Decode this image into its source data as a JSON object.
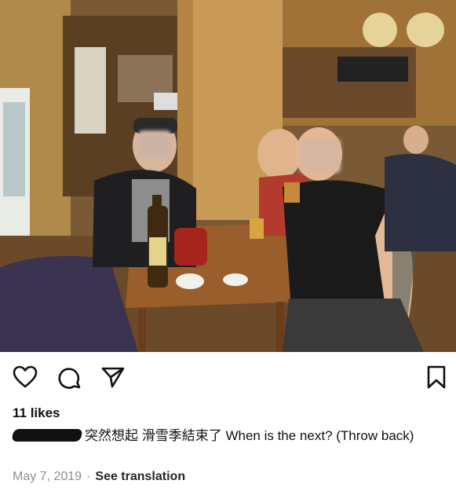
{
  "post": {
    "photo_alt": "",
    "likes": "11 likes",
    "caption": {
      "text": "突然想起 滑雪季結束了 When is the next? (Throw back)"
    },
    "date": "May 7, 2019",
    "separator": "·",
    "see_translation": "See translation"
  },
  "icons": {
    "like": "heart-icon",
    "comment": "comment-icon",
    "share": "send-icon",
    "save": "bookmark-icon"
  },
  "colors": {
    "text": "#111111",
    "meta": "#8e8e8e"
  }
}
